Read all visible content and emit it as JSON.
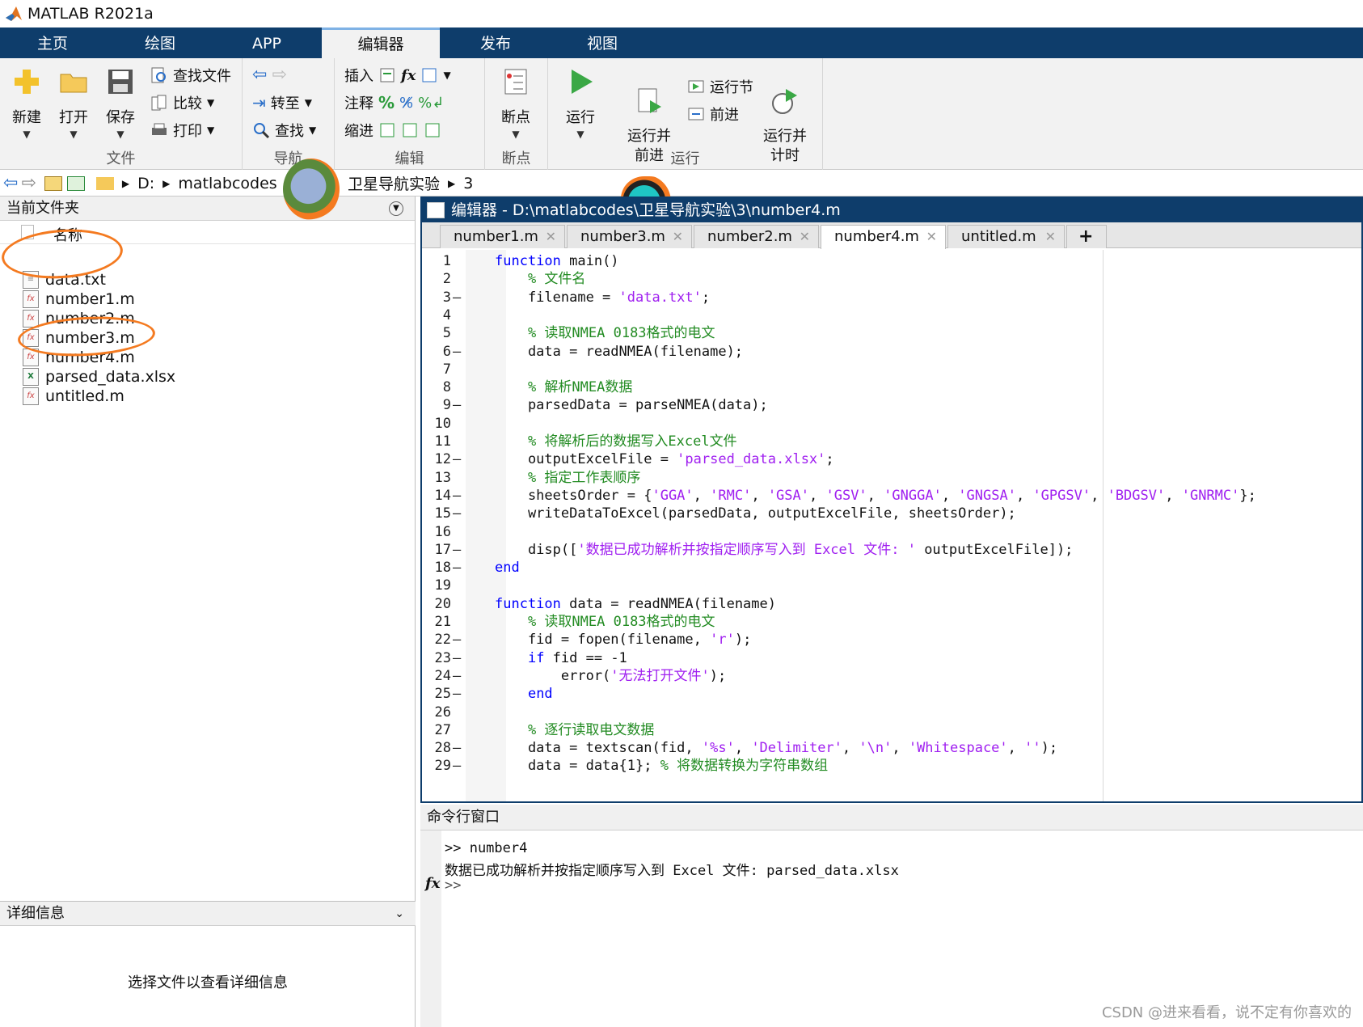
{
  "window": {
    "title": "MATLAB R2021a"
  },
  "tabs": [
    {
      "label": "主页"
    },
    {
      "label": "绘图"
    },
    {
      "label": "APP"
    },
    {
      "label": "编辑器"
    },
    {
      "label": "发布"
    },
    {
      "label": "视图"
    }
  ],
  "ribbon": {
    "file": {
      "group": "文件",
      "new": "新建",
      "open": "打开",
      "save": "保存",
      "find_files": "查找文件",
      "compare": "比较",
      "print": "打印"
    },
    "nav": {
      "group": "导航",
      "goto": "转至",
      "find": "查找"
    },
    "edit": {
      "group": "编辑",
      "insert": "插入",
      "comment": "注释",
      "indent": "缩进",
      "fx": "fx"
    },
    "breakpoints": {
      "group": "断点",
      "label": "断点"
    },
    "run": {
      "group": "运行",
      "run": "运行",
      "run_advance": "运行并\n前进",
      "run_section": "运行节",
      "advance": "前进",
      "run_time": "运行并\n计时"
    }
  },
  "address": {
    "drive": "D:",
    "folder": "matlabcodes",
    "sub1": "卫星导航实验",
    "sub2": "3"
  },
  "current_folder": {
    "title": "当前文件夹",
    "name_col": "名称",
    "files": [
      "data.txt",
      "number1.m",
      "number2.m",
      "number3.m",
      "number4.m",
      "parsed_data.xlsx",
      "untitled.m"
    ]
  },
  "details": {
    "title": "详细信息",
    "empty": "选择文件以查看详细信息"
  },
  "editor": {
    "header": "编辑器 - D:\\matlabcodes\\卫星导航实验\\3\\number4.m",
    "tabs": [
      "number1.m",
      "number3.m",
      "number2.m",
      "number4.m",
      "untitled.m"
    ],
    "active_tab": "number4.m",
    "lines": [
      {
        "n": "1",
        "d": "",
        "t": "function main()"
      },
      {
        "n": "2",
        "d": "",
        "t": "    % 文件名"
      },
      {
        "n": "3",
        "d": "–",
        "t": "    filename = 'data.txt';"
      },
      {
        "n": "4",
        "d": "",
        "t": ""
      },
      {
        "n": "5",
        "d": "",
        "t": "    % 读取NMEA 0183格式的电文"
      },
      {
        "n": "6",
        "d": "–",
        "t": "    data = readNMEA(filename);"
      },
      {
        "n": "7",
        "d": "",
        "t": ""
      },
      {
        "n": "8",
        "d": "",
        "t": "    % 解析NMEA数据"
      },
      {
        "n": "9",
        "d": "–",
        "t": "    parsedData = parseNMEA(data);"
      },
      {
        "n": "10",
        "d": "",
        "t": ""
      },
      {
        "n": "11",
        "d": "",
        "t": "    % 将解析后的数据写入Excel文件"
      },
      {
        "n": "12",
        "d": "–",
        "t": "    outputExcelFile = 'parsed_data.xlsx';"
      },
      {
        "n": "13",
        "d": "",
        "t": "    % 指定工作表顺序"
      },
      {
        "n": "14",
        "d": "–",
        "t": "    sheetsOrder = {'GGA', 'RMC', 'GSA', 'GSV', 'GNGGA', 'GNGSA', 'GPGSV', 'BDGSV', 'GNRMC'};"
      },
      {
        "n": "15",
        "d": "–",
        "t": "    writeDataToExcel(parsedData, outputExcelFile, sheetsOrder);"
      },
      {
        "n": "16",
        "d": "",
        "t": ""
      },
      {
        "n": "17",
        "d": "–",
        "t": "    disp(['数据已成功解析并按指定顺序写入到 Excel 文件: ' outputExcelFile]);"
      },
      {
        "n": "18",
        "d": "–",
        "t": "end"
      },
      {
        "n": "19",
        "d": "",
        "t": ""
      },
      {
        "n": "20",
        "d": "",
        "t": "function data = readNMEA(filename)"
      },
      {
        "n": "21",
        "d": "",
        "t": "    % 读取NMEA 0183格式的电文"
      },
      {
        "n": "22",
        "d": "–",
        "t": "    fid = fopen(filename, 'r');"
      },
      {
        "n": "23",
        "d": "–",
        "t": "    if fid == -1"
      },
      {
        "n": "24",
        "d": "–",
        "t": "        error('无法打开文件');"
      },
      {
        "n": "25",
        "d": "–",
        "t": "    end"
      },
      {
        "n": "26",
        "d": "",
        "t": ""
      },
      {
        "n": "27",
        "d": "",
        "t": "    % 逐行读取电文数据"
      },
      {
        "n": "28",
        "d": "–",
        "t": "    data = textscan(fid, '%s', 'Delimiter', '\\n', 'Whitespace', '');"
      },
      {
        "n": "29",
        "d": "–",
        "t": "    data = data{1}; % 将数据转换为字符串数组"
      }
    ]
  },
  "command": {
    "title": "命令行窗口",
    "lines": [
      ">> number4",
      "数据已成功解析并按指定顺序写入到 Excel 文件: parsed_data.xlsx",
      ">>"
    ],
    "fx": "fx"
  },
  "watermark": "CSDN @进来看看，说不定有你喜欢的",
  "colors": {
    "tabbar": "#0e3d6b",
    "keyword": "#0000ff",
    "comment": "#228b22",
    "string": "#a020f0",
    "annotation": "#f47a20"
  }
}
